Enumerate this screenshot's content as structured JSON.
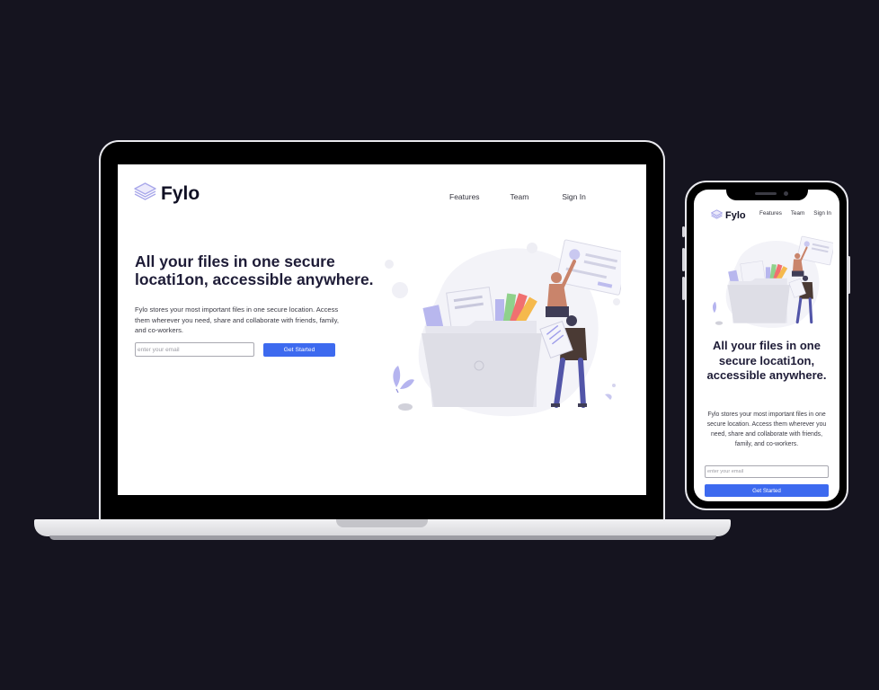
{
  "site": {
    "logo_text": "Fylo",
    "nav": {
      "features": "Features",
      "team": "Team",
      "sign_in": "Sign In"
    },
    "hero": {
      "headline": "All your files in one secure locati1on, accessible anywhere.",
      "description": "Fylo stores your most important files in one secure location. Access them wherever you need, share and collaborate with friends, family, and co-workers.",
      "email_placeholder": "enter your email",
      "cta_label": "Get Started"
    }
  },
  "colors": {
    "background": "#15141f",
    "accent": "#3d6aef",
    "headline": "#1e1c37",
    "logo_icon": "#a9a8ea"
  },
  "icons": [
    "fylo-logo-icon"
  ]
}
